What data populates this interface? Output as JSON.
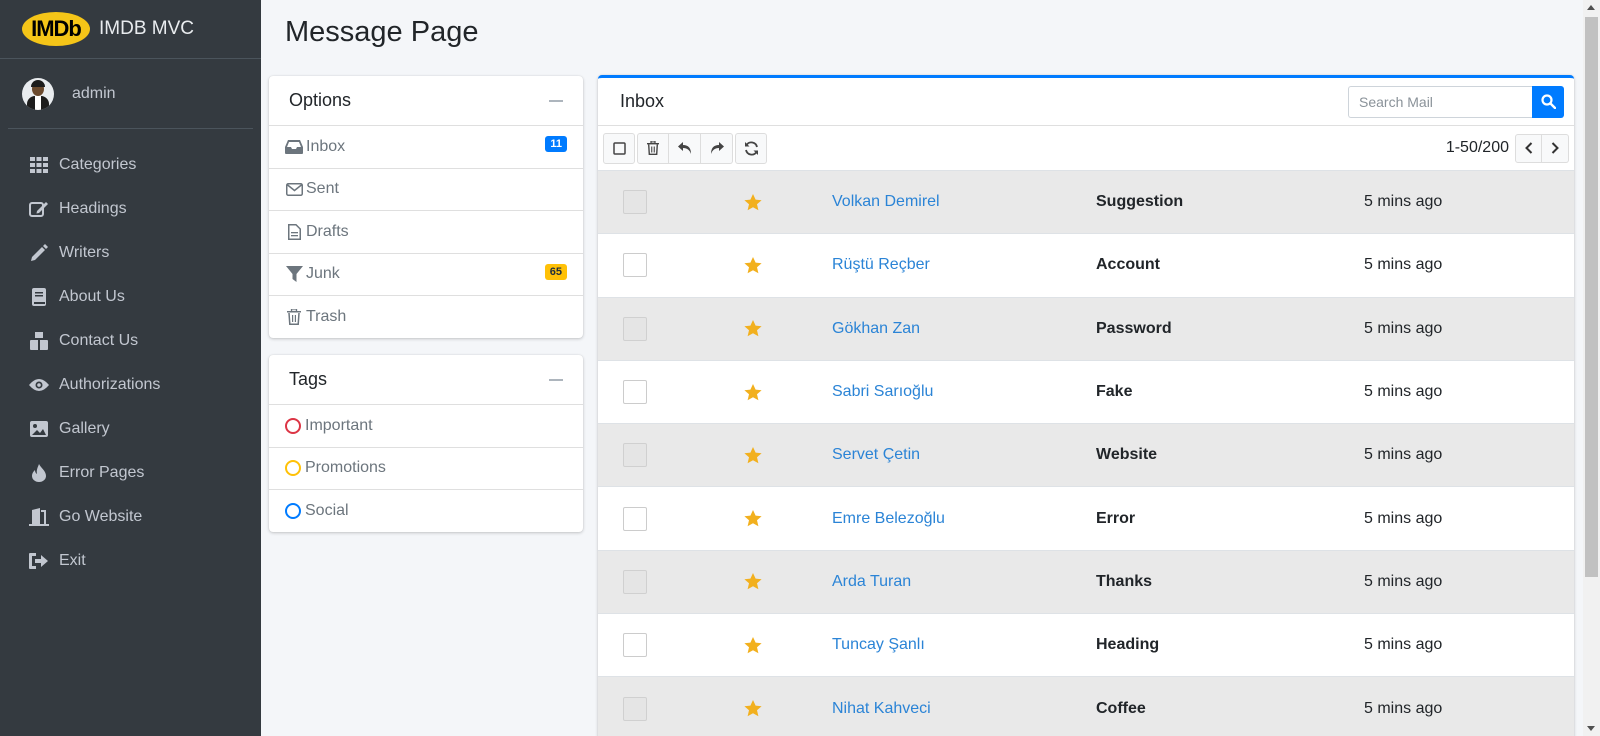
{
  "brand": {
    "logo_text": "IMDb",
    "name": "IMDB MVC"
  },
  "user": {
    "name": "admin"
  },
  "sidebar": {
    "items": [
      {
        "label": "Categories",
        "icon": "grid-icon"
      },
      {
        "label": "Headings",
        "icon": "edit-icon"
      },
      {
        "label": "Writers",
        "icon": "pencil-icon"
      },
      {
        "label": "About Us",
        "icon": "book-icon"
      },
      {
        "label": "Contact Us",
        "icon": "mail-bulk-icon"
      },
      {
        "label": "Authorizations",
        "icon": "eye-icon"
      },
      {
        "label": "Gallery",
        "icon": "image-icon"
      },
      {
        "label": "Error Pages",
        "icon": "fire-icon"
      },
      {
        "label": "Go Website",
        "icon": "door-icon"
      },
      {
        "label": "Exit",
        "icon": "sign-out-icon"
      }
    ]
  },
  "page": {
    "title": "Message Page"
  },
  "options": {
    "title": "Options",
    "folders": [
      {
        "label": "Inbox",
        "icon": "inbox-icon",
        "badge": "11",
        "badge_color": "#007bff"
      },
      {
        "label": "Sent",
        "icon": "envelope-icon"
      },
      {
        "label": "Drafts",
        "icon": "file-icon"
      },
      {
        "label": "Junk",
        "icon": "filter-icon",
        "badge": "65",
        "badge_color": "#ffc107"
      },
      {
        "label": "Trash",
        "icon": "trash-icon"
      }
    ]
  },
  "tags": {
    "title": "Tags",
    "items": [
      {
        "label": "Important",
        "color": "#dc3545"
      },
      {
        "label": "Promotions",
        "color": "#ffc107"
      },
      {
        "label": "Social",
        "color": "#007bff"
      }
    ]
  },
  "inbox": {
    "title": "Inbox",
    "search_placeholder": "Search Mail",
    "pagination": "1-50/200",
    "star_color": "#f2b01e",
    "messages": [
      {
        "sender": "Volkan Demirel",
        "subject": "Suggestion",
        "time": "5 mins ago"
      },
      {
        "sender": "Rüştü Reçber",
        "subject": "Account",
        "time": "5 mins ago"
      },
      {
        "sender": "Gökhan Zan",
        "subject": "Password",
        "time": "5 mins ago"
      },
      {
        "sender": "Sabri Sarıoğlu",
        "subject": "Fake",
        "time": "5 mins ago"
      },
      {
        "sender": "Servet Çetin",
        "subject": "Website",
        "time": "5 mins ago"
      },
      {
        "sender": "Emre Belezoğlu",
        "subject": "Error",
        "time": "5 mins ago"
      },
      {
        "sender": "Arda Turan",
        "subject": "Thanks",
        "time": "5 mins ago"
      },
      {
        "sender": "Tuncay Şanlı",
        "subject": "Heading",
        "time": "5 mins ago"
      },
      {
        "sender": "Nihat Kahveci",
        "subject": "Coffee",
        "time": "5 mins ago"
      }
    ]
  }
}
